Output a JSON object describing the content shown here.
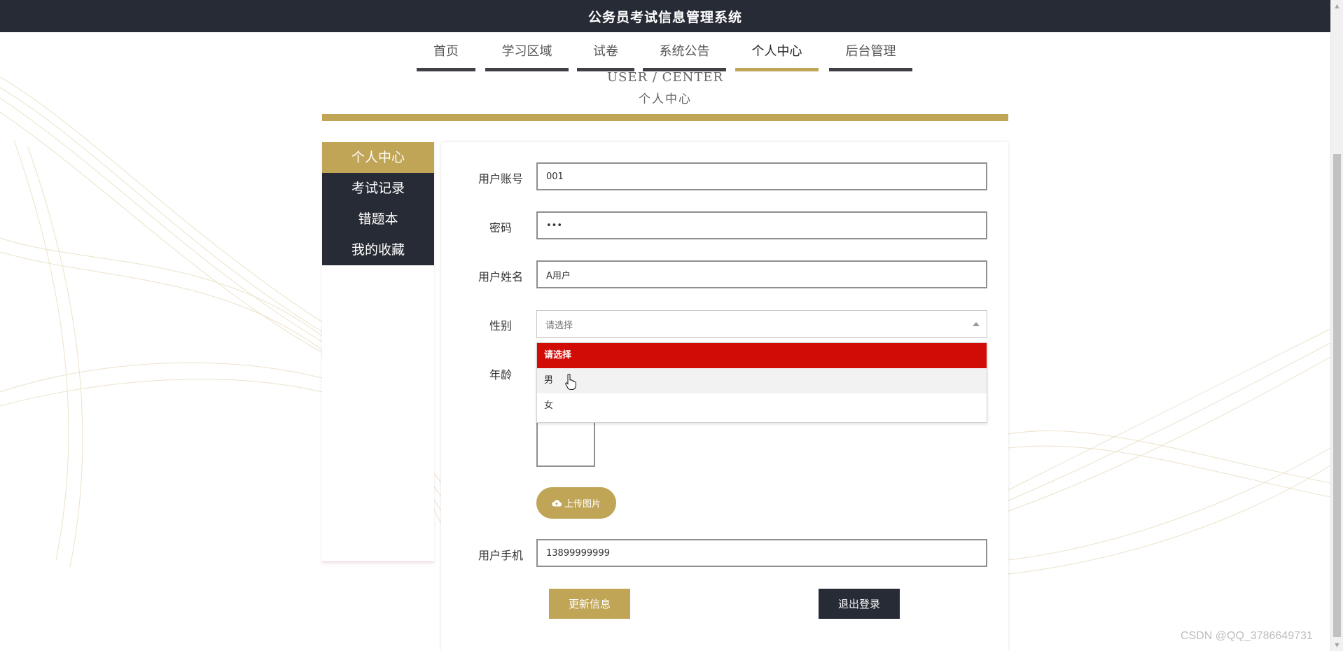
{
  "app": {
    "title": "公务员考试信息管理系统"
  },
  "nav": {
    "items": [
      "首页",
      "学习区域",
      "试卷",
      "系统公告",
      "个人中心",
      "后台管理"
    ],
    "active": "个人中心"
  },
  "section": {
    "title_en": "USER / CENTER",
    "title_cn": "个人中心"
  },
  "sidebar": {
    "items": [
      "个人中心",
      "考试记录",
      "错题本",
      "我的收藏"
    ],
    "active": "个人中心"
  },
  "form": {
    "username_label": "用户账号",
    "username_value": "001",
    "password_label": "密码",
    "password_value": "•••",
    "name_label": "用户姓名",
    "name_value": "A用户",
    "gender_label": "性别",
    "gender_placeholder": "请选择",
    "gender_options": [
      "请选择",
      "男",
      "女"
    ],
    "age_label": "年龄",
    "upload_label": "上传图片",
    "phone_label": "用户手机",
    "phone_value": "13899999999"
  },
  "buttons": {
    "update": "更新信息",
    "logout": "退出登录"
  },
  "colors": {
    "accent": "#c0a557",
    "dark": "#272b35",
    "selected_option": "#d10b05"
  },
  "watermark": "CSDN @QQ_3786649731"
}
